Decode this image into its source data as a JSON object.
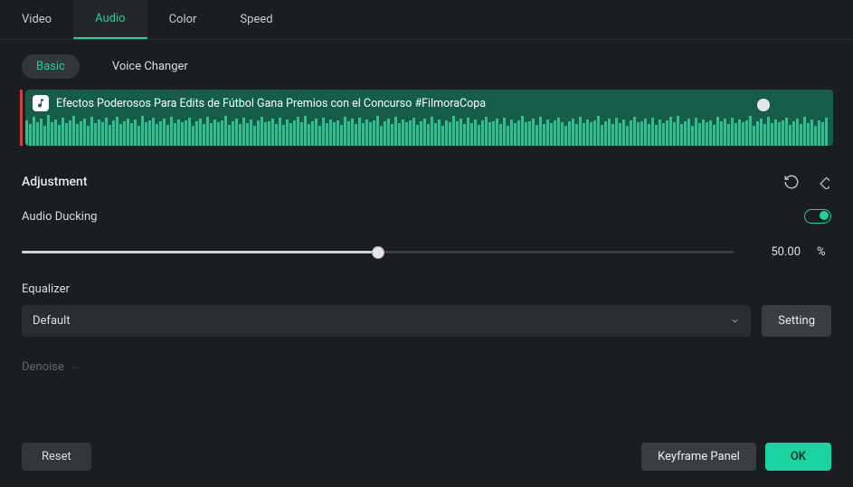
{
  "tabs": {
    "video": "Video",
    "audio": "Audio",
    "color": "Color",
    "speed": "Speed"
  },
  "subtabs": {
    "basic": "Basic",
    "voice_changer": "Voice Changer"
  },
  "waveform": {
    "title": "Efectos Poderosos Para Edits de Fútbol   Gana Premios con el Concurso #FilmoraCopa",
    "icon": "music-icon"
  },
  "adjustment": {
    "title": "Adjustment"
  },
  "ducking": {
    "label": "Audio Ducking",
    "value": "50.00",
    "unit": "%",
    "slider_percent": 50,
    "enabled": true
  },
  "equalizer": {
    "label": "Equalizer",
    "selected": "Default",
    "setting": "Setting"
  },
  "denoise": {
    "label": "Denoise"
  },
  "footer": {
    "reset": "Reset",
    "keyframe_panel": "Keyframe Panel",
    "ok": "OK"
  },
  "icons": {
    "reset_icon": "reset-icon",
    "keyframe_icon": "keyframe-icon",
    "chevron_down": "chevron-down-icon"
  }
}
